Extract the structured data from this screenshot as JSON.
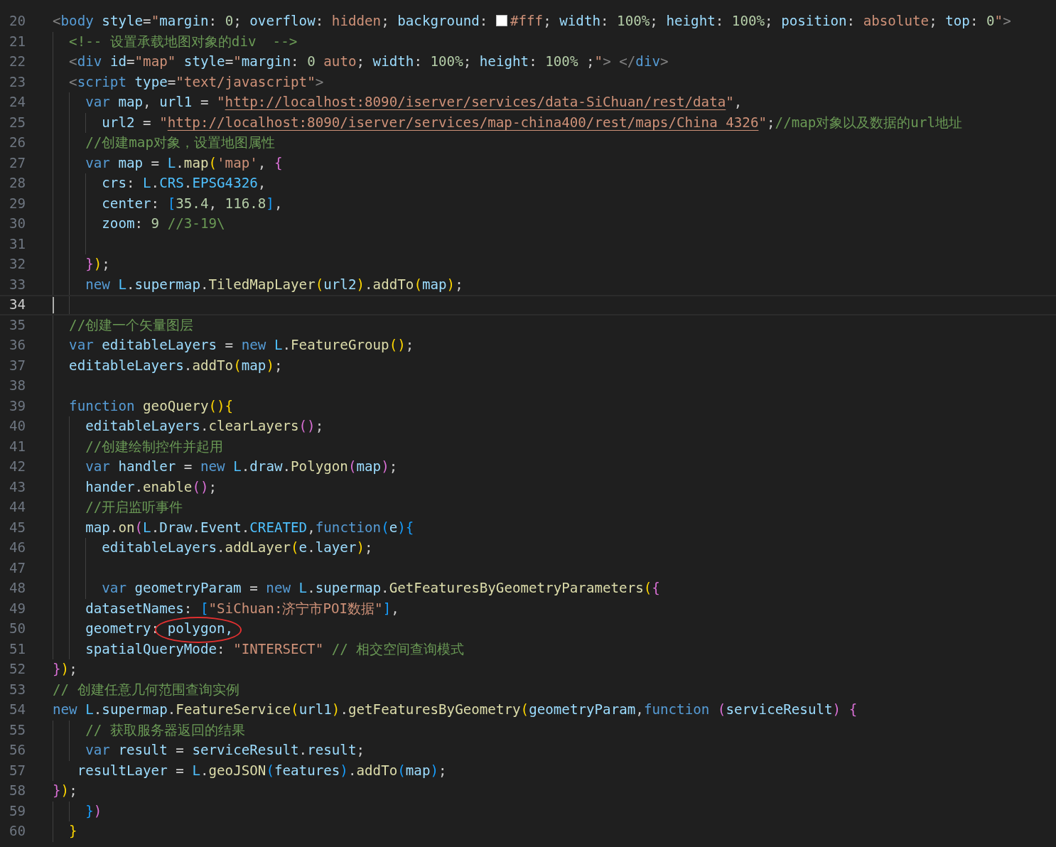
{
  "editor": {
    "lines": [
      {
        "number": "20",
        "current": false,
        "tokens": [
          {
            "kind": "tag",
            "text": "<"
          },
          {
            "kind": "kw",
            "text": "body "
          },
          {
            "kind": "var",
            "text": "style"
          },
          {
            "kind": "plain",
            "text": "="
          },
          {
            "kind": "str",
            "text": "\""
          },
          {
            "kind": "var",
            "text": "margin"
          },
          {
            "kind": "plain",
            "text": ": "
          },
          {
            "kind": "num",
            "text": "0"
          },
          {
            "kind": "plain",
            "text": "; "
          },
          {
            "kind": "var",
            "text": "overflow"
          },
          {
            "kind": "plain",
            "text": ": "
          },
          {
            "kind": "str",
            "text": "hidden"
          },
          {
            "kind": "plain",
            "text": "; "
          },
          {
            "kind": "var",
            "text": "background"
          },
          {
            "kind": "plain",
            "text": ": "
          },
          {
            "kind": "swatch",
            "color": "#ffffff"
          },
          {
            "kind": "str",
            "text": "#fff"
          },
          {
            "kind": "plain",
            "text": "; "
          },
          {
            "kind": "var",
            "text": "width"
          },
          {
            "kind": "plain",
            "text": ": "
          },
          {
            "kind": "num",
            "text": "100%"
          },
          {
            "kind": "plain",
            "text": "; "
          },
          {
            "kind": "var",
            "text": "height"
          },
          {
            "kind": "plain",
            "text": ": "
          },
          {
            "kind": "num",
            "text": "100%"
          },
          {
            "kind": "plain",
            "text": "; "
          },
          {
            "kind": "var",
            "text": "position"
          },
          {
            "kind": "plain",
            "text": ": "
          },
          {
            "kind": "str",
            "text": "absolute"
          },
          {
            "kind": "plain",
            "text": "; "
          },
          {
            "kind": "var",
            "text": "top"
          },
          {
            "kind": "plain",
            "text": ": "
          },
          {
            "kind": "num",
            "text": "0"
          },
          {
            "kind": "str",
            "text": "\""
          },
          {
            "kind": "tag",
            "text": ">"
          }
        ]
      },
      {
        "number": "21",
        "current": false,
        "tokens": [
          {
            "kind": "guide"
          },
          {
            "kind": "com",
            "text": "<!-- 设置承载地图对象的div  -->"
          }
        ]
      },
      {
        "number": "22",
        "current": false,
        "tokens": [
          {
            "kind": "guide"
          },
          {
            "kind": "tag",
            "text": "<"
          },
          {
            "kind": "kw",
            "text": "div "
          },
          {
            "kind": "var",
            "text": "id"
          },
          {
            "kind": "plain",
            "text": "="
          },
          {
            "kind": "str",
            "text": "\"map\" "
          },
          {
            "kind": "var",
            "text": "style"
          },
          {
            "kind": "plain",
            "text": "="
          },
          {
            "kind": "str",
            "text": "\""
          },
          {
            "kind": "var",
            "text": "margin"
          },
          {
            "kind": "plain",
            "text": ": "
          },
          {
            "kind": "num",
            "text": "0 "
          },
          {
            "kind": "str",
            "text": "auto"
          },
          {
            "kind": "plain",
            "text": "; "
          },
          {
            "kind": "var",
            "text": "width"
          },
          {
            "kind": "plain",
            "text": ": "
          },
          {
            "kind": "num",
            "text": "100%"
          },
          {
            "kind": "plain",
            "text": "; "
          },
          {
            "kind": "var",
            "text": "height"
          },
          {
            "kind": "plain",
            "text": ": "
          },
          {
            "kind": "num",
            "text": "100%"
          },
          {
            "kind": "plain",
            "text": " ;"
          },
          {
            "kind": "str",
            "text": "\""
          },
          {
            "kind": "tag",
            "text": "> </"
          },
          {
            "kind": "kw",
            "text": "div"
          },
          {
            "kind": "tag",
            "text": ">"
          }
        ]
      },
      {
        "number": "23",
        "current": false,
        "tokens": [
          {
            "kind": "guide"
          },
          {
            "kind": "tag",
            "text": "<"
          },
          {
            "kind": "kw",
            "text": "script "
          },
          {
            "kind": "var",
            "text": "type"
          },
          {
            "kind": "plain",
            "text": "="
          },
          {
            "kind": "str",
            "text": "\"text/javascript\""
          },
          {
            "kind": "tag",
            "text": ">"
          }
        ]
      },
      {
        "number": "24",
        "current": false,
        "tokens": [
          {
            "kind": "guide"
          },
          {
            "kind": "guide"
          },
          {
            "kind": "kw",
            "text": "var "
          },
          {
            "kind": "var",
            "text": "map"
          },
          {
            "kind": "plain",
            "text": ", "
          },
          {
            "kind": "var",
            "text": "url1"
          },
          {
            "kind": "plain",
            "text": " = "
          },
          {
            "kind": "str",
            "text": "\""
          },
          {
            "kind": "link",
            "text": "http://localhost:8090/iserver/services/data-SiChuan/rest/data"
          },
          {
            "kind": "str",
            "text": "\""
          },
          {
            "kind": "plain",
            "text": ","
          }
        ]
      },
      {
        "number": "25",
        "current": false,
        "tokens": [
          {
            "kind": "guide"
          },
          {
            "kind": "guide"
          },
          {
            "kind": "guide"
          },
          {
            "kind": "var",
            "text": "url2"
          },
          {
            "kind": "plain",
            "text": " = "
          },
          {
            "kind": "str",
            "text": "\""
          },
          {
            "kind": "link",
            "text": "http://localhost:8090/iserver/services/map-china400/rest/maps/China_4326"
          },
          {
            "kind": "str",
            "text": "\""
          },
          {
            "kind": "plain",
            "text": ";"
          },
          {
            "kind": "com",
            "text": "//map对象以及数据的url地址"
          }
        ]
      },
      {
        "number": "26",
        "current": false,
        "tokens": [
          {
            "kind": "guide"
          },
          {
            "kind": "guide"
          },
          {
            "kind": "com",
            "text": "//创建map对象，设置地图属性"
          }
        ]
      },
      {
        "number": "27",
        "current": false,
        "tokens": [
          {
            "kind": "guide"
          },
          {
            "kind": "guide"
          },
          {
            "kind": "kw",
            "text": "var "
          },
          {
            "kind": "var",
            "text": "map"
          },
          {
            "kind": "plain",
            "text": " = "
          },
          {
            "kind": "const",
            "text": "L"
          },
          {
            "kind": "plain",
            "text": "."
          },
          {
            "kind": "fn",
            "text": "map"
          },
          {
            "kind": "b1",
            "text": "("
          },
          {
            "kind": "str",
            "text": "'map'"
          },
          {
            "kind": "plain",
            "text": ", "
          },
          {
            "kind": "b2",
            "text": "{"
          }
        ]
      },
      {
        "number": "28",
        "current": false,
        "tokens": [
          {
            "kind": "guide"
          },
          {
            "kind": "guide"
          },
          {
            "kind": "guide"
          },
          {
            "kind": "var",
            "text": "crs"
          },
          {
            "kind": "plain",
            "text": ": "
          },
          {
            "kind": "const",
            "text": "L"
          },
          {
            "kind": "plain",
            "text": "."
          },
          {
            "kind": "const",
            "text": "CRS"
          },
          {
            "kind": "plain",
            "text": "."
          },
          {
            "kind": "const",
            "text": "EPSG4326"
          },
          {
            "kind": "plain",
            "text": ","
          }
        ]
      },
      {
        "number": "29",
        "current": false,
        "tokens": [
          {
            "kind": "guide"
          },
          {
            "kind": "guide"
          },
          {
            "kind": "guide"
          },
          {
            "kind": "var",
            "text": "center"
          },
          {
            "kind": "plain",
            "text": ": "
          },
          {
            "kind": "b3",
            "text": "["
          },
          {
            "kind": "num",
            "text": "35.4"
          },
          {
            "kind": "plain",
            "text": ", "
          },
          {
            "kind": "num",
            "text": "116.8"
          },
          {
            "kind": "b3",
            "text": "]"
          },
          {
            "kind": "plain",
            "text": ","
          }
        ]
      },
      {
        "number": "30",
        "current": false,
        "tokens": [
          {
            "kind": "guide"
          },
          {
            "kind": "guide"
          },
          {
            "kind": "guide"
          },
          {
            "kind": "var",
            "text": "zoom"
          },
          {
            "kind": "plain",
            "text": ": "
          },
          {
            "kind": "num",
            "text": "9 "
          },
          {
            "kind": "com",
            "text": "//3-19\\"
          }
        ]
      },
      {
        "number": "31",
        "current": false,
        "tokens": [
          {
            "kind": "guide"
          },
          {
            "kind": "guide"
          },
          {
            "kind": "guide"
          }
        ]
      },
      {
        "number": "32",
        "current": false,
        "tokens": [
          {
            "kind": "guide"
          },
          {
            "kind": "guide"
          },
          {
            "kind": "b2",
            "text": "}"
          },
          {
            "kind": "b1",
            "text": ")"
          },
          {
            "kind": "plain",
            "text": ";"
          }
        ]
      },
      {
        "number": "33",
        "current": false,
        "tokens": [
          {
            "kind": "guide"
          },
          {
            "kind": "guide"
          },
          {
            "kind": "kw",
            "text": "new "
          },
          {
            "kind": "const",
            "text": "L"
          },
          {
            "kind": "plain",
            "text": "."
          },
          {
            "kind": "var",
            "text": "supermap"
          },
          {
            "kind": "plain",
            "text": "."
          },
          {
            "kind": "fn",
            "text": "TiledMapLayer"
          },
          {
            "kind": "b1",
            "text": "("
          },
          {
            "kind": "var",
            "text": "url2"
          },
          {
            "kind": "b1",
            "text": ")"
          },
          {
            "kind": "plain",
            "text": "."
          },
          {
            "kind": "fn",
            "text": "addTo"
          },
          {
            "kind": "b1",
            "text": "("
          },
          {
            "kind": "var",
            "text": "map"
          },
          {
            "kind": "b1",
            "text": ")"
          },
          {
            "kind": "plain",
            "text": ";"
          }
        ]
      },
      {
        "number": "34",
        "current": true,
        "tokens": [
          {
            "kind": "guide"
          },
          {
            "kind": "guide"
          }
        ]
      },
      {
        "number": "35",
        "current": false,
        "tokens": [
          {
            "kind": "guide"
          },
          {
            "kind": "com",
            "text": "//创建一个矢量图层"
          }
        ]
      },
      {
        "number": "36",
        "current": false,
        "tokens": [
          {
            "kind": "guide"
          },
          {
            "kind": "kw",
            "text": "var "
          },
          {
            "kind": "var",
            "text": "editableLayers"
          },
          {
            "kind": "plain",
            "text": " = "
          },
          {
            "kind": "kw",
            "text": "new "
          },
          {
            "kind": "const",
            "text": "L"
          },
          {
            "kind": "plain",
            "text": "."
          },
          {
            "kind": "fn",
            "text": "FeatureGroup"
          },
          {
            "kind": "b1",
            "text": "()"
          },
          {
            "kind": "plain",
            "text": ";"
          }
        ]
      },
      {
        "number": "37",
        "current": false,
        "tokens": [
          {
            "kind": "guide"
          },
          {
            "kind": "var",
            "text": "editableLayers"
          },
          {
            "kind": "plain",
            "text": "."
          },
          {
            "kind": "fn",
            "text": "addTo"
          },
          {
            "kind": "b1",
            "text": "("
          },
          {
            "kind": "var",
            "text": "map"
          },
          {
            "kind": "b1",
            "text": ")"
          },
          {
            "kind": "plain",
            "text": ";"
          }
        ]
      },
      {
        "number": "38",
        "current": false,
        "tokens": [
          {
            "kind": "guide"
          }
        ]
      },
      {
        "number": "39",
        "current": false,
        "tokens": [
          {
            "kind": "guide"
          },
          {
            "kind": "kw",
            "text": "function "
          },
          {
            "kind": "fn",
            "text": "geoQuery"
          },
          {
            "kind": "b1",
            "text": "(){"
          }
        ]
      },
      {
        "number": "40",
        "current": false,
        "tokens": [
          {
            "kind": "guide"
          },
          {
            "kind": "guide"
          },
          {
            "kind": "var",
            "text": "editableLayers"
          },
          {
            "kind": "plain",
            "text": "."
          },
          {
            "kind": "fn",
            "text": "clearLayers"
          },
          {
            "kind": "b2",
            "text": "()"
          },
          {
            "kind": "plain",
            "text": ";"
          }
        ]
      },
      {
        "number": "41",
        "current": false,
        "tokens": [
          {
            "kind": "guide"
          },
          {
            "kind": "guide"
          },
          {
            "kind": "com",
            "text": "//创建绘制控件并起用"
          }
        ]
      },
      {
        "number": "42",
        "current": false,
        "tokens": [
          {
            "kind": "guide"
          },
          {
            "kind": "guide"
          },
          {
            "kind": "kw",
            "text": "var "
          },
          {
            "kind": "var",
            "text": "handler"
          },
          {
            "kind": "plain",
            "text": " = "
          },
          {
            "kind": "kw",
            "text": "new "
          },
          {
            "kind": "const",
            "text": "L"
          },
          {
            "kind": "plain",
            "text": "."
          },
          {
            "kind": "var",
            "text": "draw"
          },
          {
            "kind": "plain",
            "text": "."
          },
          {
            "kind": "fn",
            "text": "Polygon"
          },
          {
            "kind": "b2",
            "text": "("
          },
          {
            "kind": "var",
            "text": "map"
          },
          {
            "kind": "b2",
            "text": ")"
          },
          {
            "kind": "plain",
            "text": ";"
          }
        ]
      },
      {
        "number": "43",
        "current": false,
        "tokens": [
          {
            "kind": "guide"
          },
          {
            "kind": "guide"
          },
          {
            "kind": "var",
            "text": "hander"
          },
          {
            "kind": "plain",
            "text": "."
          },
          {
            "kind": "fn",
            "text": "enable"
          },
          {
            "kind": "b2",
            "text": "()"
          },
          {
            "kind": "plain",
            "text": ";"
          }
        ]
      },
      {
        "number": "44",
        "current": false,
        "tokens": [
          {
            "kind": "guide"
          },
          {
            "kind": "guide"
          },
          {
            "kind": "com",
            "text": "//开启监听事件"
          }
        ]
      },
      {
        "number": "45",
        "current": false,
        "tokens": [
          {
            "kind": "guide"
          },
          {
            "kind": "guide"
          },
          {
            "kind": "var",
            "text": "map"
          },
          {
            "kind": "plain",
            "text": "."
          },
          {
            "kind": "fn",
            "text": "on"
          },
          {
            "kind": "b2",
            "text": "("
          },
          {
            "kind": "const",
            "text": "L"
          },
          {
            "kind": "plain",
            "text": "."
          },
          {
            "kind": "var",
            "text": "Draw"
          },
          {
            "kind": "plain",
            "text": "."
          },
          {
            "kind": "var",
            "text": "Event"
          },
          {
            "kind": "plain",
            "text": "."
          },
          {
            "kind": "const",
            "text": "CREATED"
          },
          {
            "kind": "plain",
            "text": ","
          },
          {
            "kind": "kw",
            "text": "function"
          },
          {
            "kind": "b3",
            "text": "("
          },
          {
            "kind": "var",
            "text": "e"
          },
          {
            "kind": "b3",
            "text": "){"
          }
        ]
      },
      {
        "number": "46",
        "current": false,
        "tokens": [
          {
            "kind": "guide"
          },
          {
            "kind": "guide"
          },
          {
            "kind": "guide"
          },
          {
            "kind": "var",
            "text": "editableLayers"
          },
          {
            "kind": "plain",
            "text": "."
          },
          {
            "kind": "fn",
            "text": "addLayer"
          },
          {
            "kind": "b1",
            "text": "("
          },
          {
            "kind": "var",
            "text": "e"
          },
          {
            "kind": "plain",
            "text": "."
          },
          {
            "kind": "var",
            "text": "layer"
          },
          {
            "kind": "b1",
            "text": ")"
          },
          {
            "kind": "plain",
            "text": ";"
          }
        ]
      },
      {
        "number": "47",
        "current": false,
        "tokens": [
          {
            "kind": "guide"
          },
          {
            "kind": "guide"
          },
          {
            "kind": "guide"
          }
        ]
      },
      {
        "number": "48",
        "current": false,
        "tokens": [
          {
            "kind": "guide"
          },
          {
            "kind": "guide"
          },
          {
            "kind": "guide"
          },
          {
            "kind": "kw",
            "text": "var "
          },
          {
            "kind": "var",
            "text": "geometryParam"
          },
          {
            "kind": "plain",
            "text": " = "
          },
          {
            "kind": "kw",
            "text": "new "
          },
          {
            "kind": "const",
            "text": "L"
          },
          {
            "kind": "plain",
            "text": "."
          },
          {
            "kind": "var",
            "text": "supermap"
          },
          {
            "kind": "plain",
            "text": "."
          },
          {
            "kind": "fn",
            "text": "GetFeaturesByGeometryParameters"
          },
          {
            "kind": "b1",
            "text": "("
          },
          {
            "kind": "b2",
            "text": "{"
          }
        ]
      },
      {
        "number": "49",
        "current": false,
        "tokens": [
          {
            "kind": "guide"
          },
          {
            "kind": "guide"
          },
          {
            "kind": "var",
            "text": "datasetNames"
          },
          {
            "kind": "plain",
            "text": ": "
          },
          {
            "kind": "b3",
            "text": "["
          },
          {
            "kind": "str",
            "text": "\"SiChuan:济宁市POI数据\""
          },
          {
            "kind": "b3",
            "text": "]"
          },
          {
            "kind": "plain",
            "text": ","
          }
        ]
      },
      {
        "number": "50",
        "current": false,
        "tokens": [
          {
            "kind": "guide"
          },
          {
            "kind": "guide"
          },
          {
            "kind": "var",
            "text": "geometry"
          },
          {
            "kind": "plain",
            "text": ": "
          },
          {
            "kind": "var",
            "text": "polygon,",
            "circled": true
          }
        ]
      },
      {
        "number": "51",
        "current": false,
        "tokens": [
          {
            "kind": "guide"
          },
          {
            "kind": "guide"
          },
          {
            "kind": "var",
            "text": "spatialQueryMode"
          },
          {
            "kind": "plain",
            "text": ": "
          },
          {
            "kind": "str",
            "text": "\"INTERSECT\" "
          },
          {
            "kind": "com",
            "text": "// 相交空间查询模式"
          }
        ]
      },
      {
        "number": "52",
        "current": false,
        "tokens": [
          {
            "kind": "b2",
            "text": "}"
          },
          {
            "kind": "b1",
            "text": ")"
          },
          {
            "kind": "plain",
            "text": ";"
          }
        ]
      },
      {
        "number": "53",
        "current": false,
        "tokens": [
          {
            "kind": "com",
            "text": "// 创建任意几何范围查询实例"
          }
        ]
      },
      {
        "number": "54",
        "current": false,
        "tokens": [
          {
            "kind": "kw",
            "text": "new "
          },
          {
            "kind": "const",
            "text": "L"
          },
          {
            "kind": "plain",
            "text": "."
          },
          {
            "kind": "var",
            "text": "supermap"
          },
          {
            "kind": "plain",
            "text": "."
          },
          {
            "kind": "fn",
            "text": "FeatureService"
          },
          {
            "kind": "b1",
            "text": "("
          },
          {
            "kind": "var",
            "text": "url1"
          },
          {
            "kind": "b1",
            "text": ")"
          },
          {
            "kind": "plain",
            "text": "."
          },
          {
            "kind": "fn",
            "text": "getFeaturesByGeometry"
          },
          {
            "kind": "b1",
            "text": "("
          },
          {
            "kind": "var",
            "text": "geometryParam"
          },
          {
            "kind": "plain",
            "text": ","
          },
          {
            "kind": "kw",
            "text": "function "
          },
          {
            "kind": "b2",
            "text": "("
          },
          {
            "kind": "var",
            "text": "serviceResult"
          },
          {
            "kind": "b2",
            "text": ") {"
          }
        ]
      },
      {
        "number": "55",
        "current": false,
        "tokens": [
          {
            "kind": "guide"
          },
          {
            "kind": "guide"
          },
          {
            "kind": "com",
            "text": "// 获取服务器返回的结果"
          }
        ]
      },
      {
        "number": "56",
        "current": false,
        "tokens": [
          {
            "kind": "guide"
          },
          {
            "kind": "guide"
          },
          {
            "kind": "kw",
            "text": "var "
          },
          {
            "kind": "var",
            "text": "result"
          },
          {
            "kind": "plain",
            "text": " = "
          },
          {
            "kind": "var",
            "text": "serviceResult"
          },
          {
            "kind": "plain",
            "text": "."
          },
          {
            "kind": "var",
            "text": "result"
          },
          {
            "kind": "plain",
            "text": ";"
          }
        ]
      },
      {
        "number": "57",
        "current": false,
        "tokens": [
          {
            "kind": "guide"
          },
          {
            "kind": "pad"
          },
          {
            "kind": "var",
            "text": "resultLayer"
          },
          {
            "kind": "plain",
            "text": " = "
          },
          {
            "kind": "const",
            "text": "L"
          },
          {
            "kind": "plain",
            "text": "."
          },
          {
            "kind": "fn",
            "text": "geoJSON"
          },
          {
            "kind": "b3",
            "text": "("
          },
          {
            "kind": "var",
            "text": "features"
          },
          {
            "kind": "b3",
            "text": ")"
          },
          {
            "kind": "plain",
            "text": "."
          },
          {
            "kind": "fn",
            "text": "addTo"
          },
          {
            "kind": "b3",
            "text": "("
          },
          {
            "kind": "var",
            "text": "map"
          },
          {
            "kind": "b3",
            "text": ")"
          },
          {
            "kind": "plain",
            "text": ";"
          }
        ]
      },
      {
        "number": "58",
        "current": false,
        "tokens": [
          {
            "kind": "b2",
            "text": "}"
          },
          {
            "kind": "b1",
            "text": ")"
          },
          {
            "kind": "plain",
            "text": ";"
          }
        ]
      },
      {
        "number": "59",
        "current": false,
        "tokens": [
          {
            "kind": "guide"
          },
          {
            "kind": "guide"
          },
          {
            "kind": "b3",
            "text": "}"
          },
          {
            "kind": "b2",
            "text": ")"
          }
        ]
      },
      {
        "number": "60",
        "current": false,
        "tokens": [
          {
            "kind": "guide"
          },
          {
            "kind": "b1",
            "text": "}"
          }
        ]
      }
    ]
  }
}
